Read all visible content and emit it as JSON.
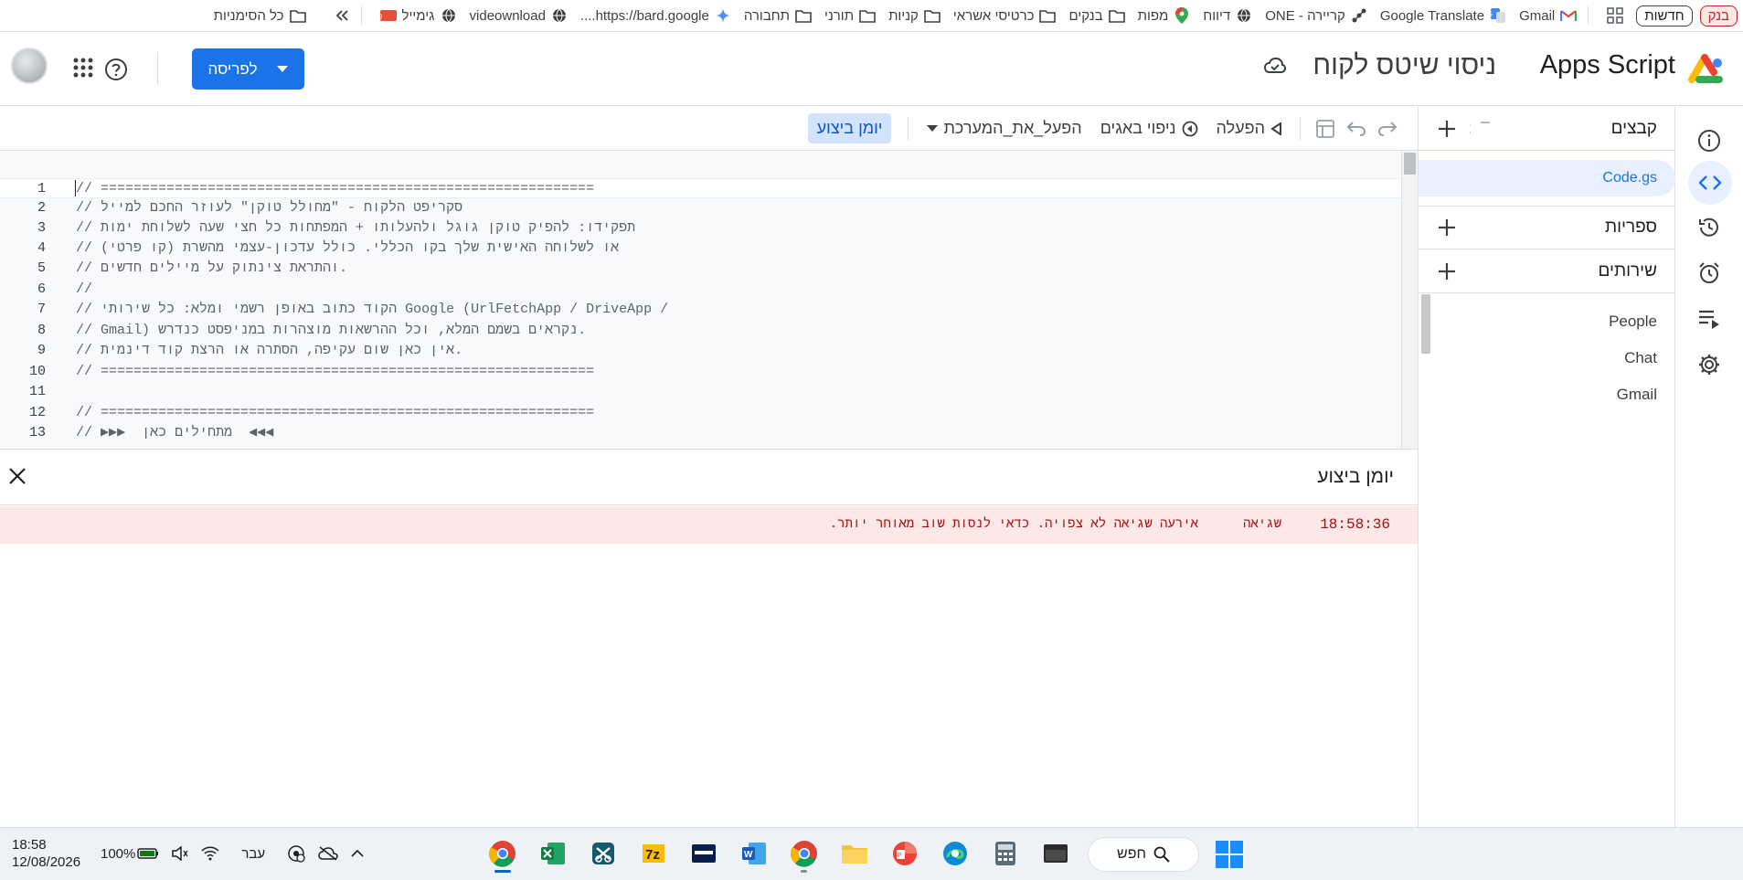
{
  "bookmarks": {
    "pill_red": "בנק",
    "pill_news": "חדשות",
    "items": [
      {
        "label": "Gmail",
        "icon": "gmail-icon"
      },
      {
        "label": "Google Translate",
        "icon": "translate-icon"
      },
      {
        "label": "קריירה - ONE",
        "icon": "network-icon"
      },
      {
        "label": "דיווח",
        "icon": "globe-icon"
      },
      {
        "label": "מפות",
        "icon": "maps-pin-icon"
      },
      {
        "label": "בנקים",
        "icon": "folder-icon"
      },
      {
        "label": "כרטיסי אשראי",
        "icon": "folder-icon"
      },
      {
        "label": "קניות",
        "icon": "folder-icon"
      },
      {
        "label": "תורני",
        "icon": "folder-icon"
      },
      {
        "label": "תחבורה",
        "icon": "folder-icon"
      },
      {
        "label": "https://bard.google....",
        "icon": "gemini-icon"
      },
      {
        "label": "videownload",
        "icon": "globe-icon"
      },
      {
        "label": "גימייל",
        "icon": "globe-icon"
      }
    ],
    "all_bookmarks": "כל הסימניות"
  },
  "header": {
    "app_name": "Apps Script",
    "project_name": "ניסוי שיטס לקוח",
    "deploy_label": "לפריסה"
  },
  "files_panel": {
    "files_title": "קבצים",
    "file": "Code.gs",
    "libraries_title": "ספריות",
    "services_title": "שירותים",
    "services": [
      "People",
      "Chat",
      "Gmail"
    ]
  },
  "toolbar": {
    "run_label": "הפעלה",
    "debug_label": "ניפוי באגים",
    "function_name": "הפעל_את_המערכת",
    "exec_log_label": "יומן ביצוע"
  },
  "editor": {
    "lines": [
      {
        "n": "1",
        "text": "// ============================================================"
      },
      {
        "n": "2",
        "text": "// סקריפט הלקוח - \"מחולל טוקן\" לעוזר החכם למייל"
      },
      {
        "n": "3",
        "text": "// תפקידו: להפיק טוקן גוגל ולהעלותו + המפתחות כל חצי שעה לשלוחת ימות"
      },
      {
        "n": "4",
        "text": "// או לשלוחה האישית שלך בקו הכללי. כולל עדכון-עצמי מהשרת (קו פרטי)"
      },
      {
        "n": "5",
        "text": "// והתראת צינתוק על מיילים חדשים."
      },
      {
        "n": "6",
        "text": "//"
      },
      {
        "n": "7",
        "text": "// הקוד כתוב באופן רשמי ומלא: כל שירותי Google (UrlFetchApp / DriveApp /"
      },
      {
        "n": "8",
        "text": "// Gmail) נקראים בשמם המלא, וכל ההרשאות מוצהרות במניפסט כנדרש."
      },
      {
        "n": "9",
        "text": "// אין כאן שום עקיפה, הסתרה או הרצת קוד דינמית."
      },
      {
        "n": "10",
        "text": "// ============================================================"
      },
      {
        "n": "11",
        "text": ""
      },
      {
        "n": "12",
        "text": "// ============================================================"
      },
      {
        "n": "13",
        "text": "// ▶▶▶  מתחילים כאן  ◀◀◀"
      }
    ]
  },
  "exec_log": {
    "title": "יומן ביצוע",
    "rows": [
      {
        "time": "18:58:36",
        "level": "שגיאה",
        "message": "אירעה שגיאה לא צפויה. כדאי לנסות שוב מאוחר יותר."
      }
    ]
  },
  "taskbar": {
    "time": "18:58",
    "date": "12/08/2026",
    "battery": "100%",
    "language": "עבר",
    "search_label": "חפש"
  }
}
